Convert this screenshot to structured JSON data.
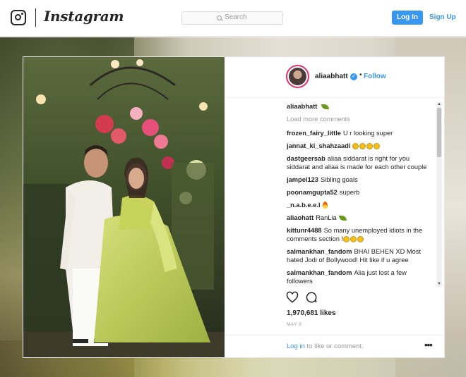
{
  "nav": {
    "brand": "Instagram",
    "search_placeholder": "Search",
    "login_label": "Log In",
    "signup_label": "Sign Up"
  },
  "post": {
    "username": "aliaabhatt",
    "follow_label": "Follow",
    "separator": "•",
    "caption_user": "aliaabhatt",
    "load_more": "Load more comments",
    "comments": [
      {
        "user": "frozen_fairy_little",
        "text": "U r looking super"
      },
      {
        "user": "jannat_ki_shahzaadi",
        "text": ""
      },
      {
        "user": "dastgeersab",
        "text": "aliaa siddarat is right for you siddarat and aliaa is made for each other couple"
      },
      {
        "user": "jampel123",
        "text": "Sibling goals"
      },
      {
        "user": "poonamgupta52",
        "text": "superb"
      },
      {
        "user": "_n.a.b.e.e.l",
        "text": ""
      },
      {
        "user": "aliaohatt",
        "text": "RanLia"
      },
      {
        "user": "kittunr4488",
        "text": "So many unemployed idiots in the comments section !"
      },
      {
        "user": "salmankhan_fandom",
        "text": "BHAI BEHEN XD Most hated Jodi of Bollywood! Hit like if u agree"
      },
      {
        "user": "salmankhan_fandom",
        "text": "Alia just lost a few followers"
      }
    ],
    "likes": "1,970,681 likes",
    "date": "MAY 9",
    "login_prompt_link": "Log in",
    "login_prompt_rest": " to like or comment.",
    "more_label": "•••"
  },
  "icons": [
    "instagram-logo-icon",
    "search-icon",
    "verified-icon",
    "leaf-icon",
    "emoji-icon",
    "fire-icon",
    "heart-icon",
    "comment-icon",
    "more-options-icon"
  ],
  "colors": {
    "accent": "#3897f0",
    "text": "#262626",
    "muted": "#999999",
    "border": "#dbdbdb"
  }
}
